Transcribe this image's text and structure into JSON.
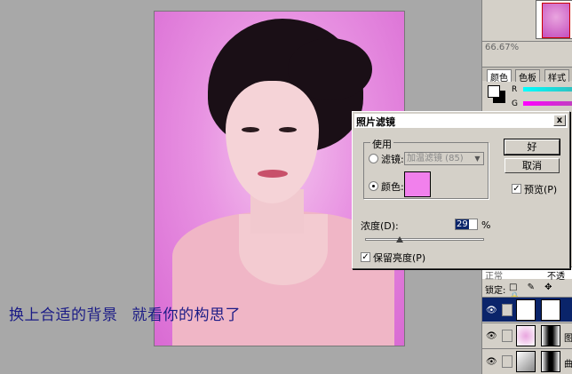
{
  "caption": {
    "part1": "换上合适的背景",
    "part2": "就看你的构思了"
  },
  "navigator": {
    "zoom": "66.67%"
  },
  "color_panel": {
    "tabs": [
      "颜色",
      "色板",
      "样式"
    ],
    "channels": [
      "R",
      "G"
    ]
  },
  "layers_panel": {
    "blend_mode": "正常",
    "opacity_label": "不透",
    "lock_label": "锁定:",
    "lock_icons": "□ ✎ ✥ 🔒",
    "layer_names": [
      "",
      "图",
      "曲"
    ]
  },
  "dialog": {
    "title": "照片滤镜",
    "group_label": "使用",
    "filter_label": "滤镜:",
    "filter_value": "加温滤镜 (85)",
    "color_label": "颜色:",
    "color_value": "#f180ec",
    "ok_label": "好",
    "cancel_label": "取消",
    "preview_label": "预览(P)",
    "preview_checked": true,
    "density_label": "浓度(D):",
    "density_value": "29",
    "density_unit": "%",
    "density_fraction": 0.29,
    "preserve_label": "保留亮度(P)",
    "preserve_checked": true,
    "close_symbol": "x"
  }
}
